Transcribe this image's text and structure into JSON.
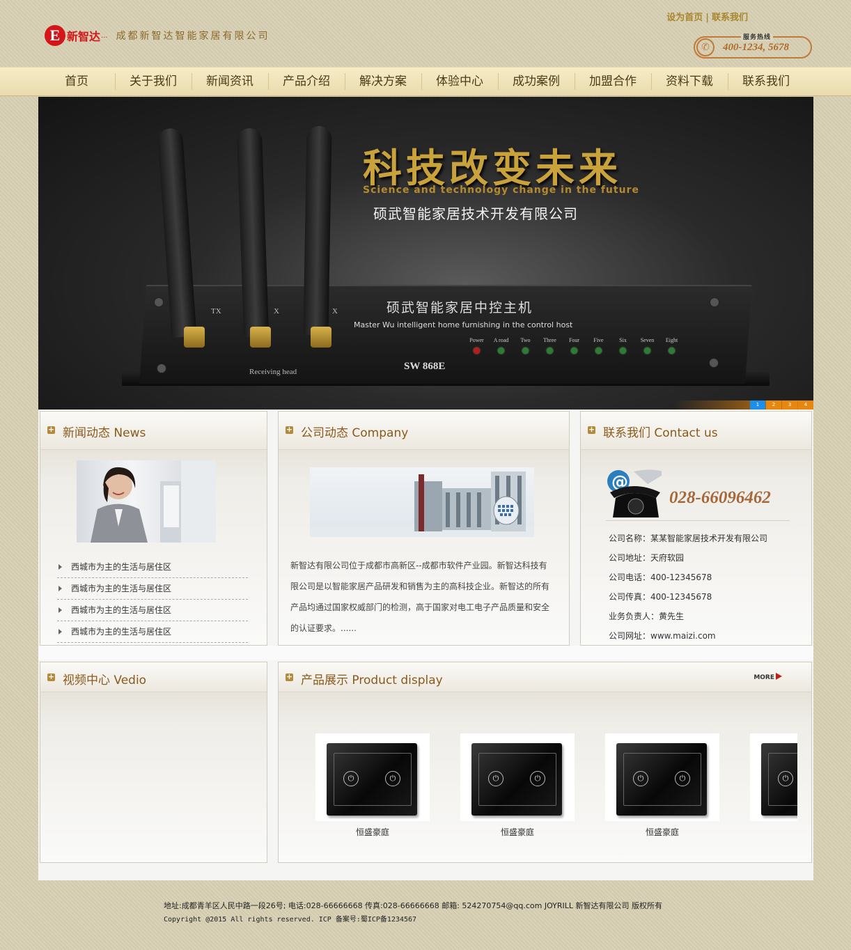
{
  "header": {
    "logo_mark": "E",
    "logo_name": "新智达",
    "logo_dots": "...",
    "company_name": "成都新智达智能家居有限公司",
    "top_links": [
      "设为首页",
      "联系我们"
    ],
    "hotline_label": "服务热线",
    "hotline_number": "400-1234, 5678"
  },
  "nav": [
    "首页",
    "关于我们",
    "新闻资讯",
    "产品介绍",
    "解决方案",
    "体验中心",
    "成功案例",
    "加盟合作",
    "资料下载",
    "联系我们"
  ],
  "banner": {
    "title": "科技改变未来",
    "subtitle": "Science and technology change in the future",
    "company": "硕武智能家居技术开发有限公司",
    "device_name": "硕武智能家居中控主机",
    "device_desc": "Master Wu intelligent home furnishing in the control host",
    "device_model": "SW 868E",
    "receiving": "Receiving head",
    "antenna_labels": [
      "TX",
      "X",
      "X"
    ],
    "leds": [
      "Power",
      "A road",
      "Two",
      "Three",
      "Four",
      "Five",
      "Six",
      "Seven",
      "Eight"
    ],
    "pager": [
      "1",
      "2",
      "3",
      "4"
    ]
  },
  "news": {
    "title": "新闻动态 News",
    "items": [
      "西城市为主的生活与居住区",
      "西城市为主的生活与居住区",
      "西城市为主的生活与居住区",
      "西城市为主的生活与居住区"
    ]
  },
  "company": {
    "title": "公司动态 Company",
    "text": "新智达有限公司位于成都市高新区--成都市软件产业园。新智达科技有限公司是以智能家居产品研发和销售为主的高科技企业。新智达的所有产品均通过国家权威部门的检测，高于国家对电工电子产品质量和安全的认证要求。......"
  },
  "contact": {
    "title": "联系我们 Contact us",
    "phone": "028-66096462",
    "lines": [
      "公司名称：某某智能家居技术开发有限公司",
      "公司地址：天府软园",
      "公司电话：400-12345678",
      "公司传真：400-12345678",
      "业务负责人：黄先生",
      "公司网址：www.maizi.com"
    ]
  },
  "video": {
    "title": "视频中心 Vedio"
  },
  "products": {
    "title": "产品展示 Product display",
    "more": "MORE",
    "items": [
      "恒盛豪庭",
      "恒盛豪庭",
      "恒盛豪庭",
      ""
    ]
  },
  "footer": {
    "line1": "地址:成都青羊区人民中路一段26号; 电话:028-66666668 传真:028-66666668 邮箱: 524270754@qq.com JOYRILL 新智达有限公司 版权所有",
    "line2": "Copyright @2015 All rights reserved. ICP 备案号:蜀ICP备1234567"
  },
  "colors": {
    "brand_red": "#d4161b",
    "accent_gold": "#b5893a",
    "nav_bg": "#f0e4ba"
  }
}
